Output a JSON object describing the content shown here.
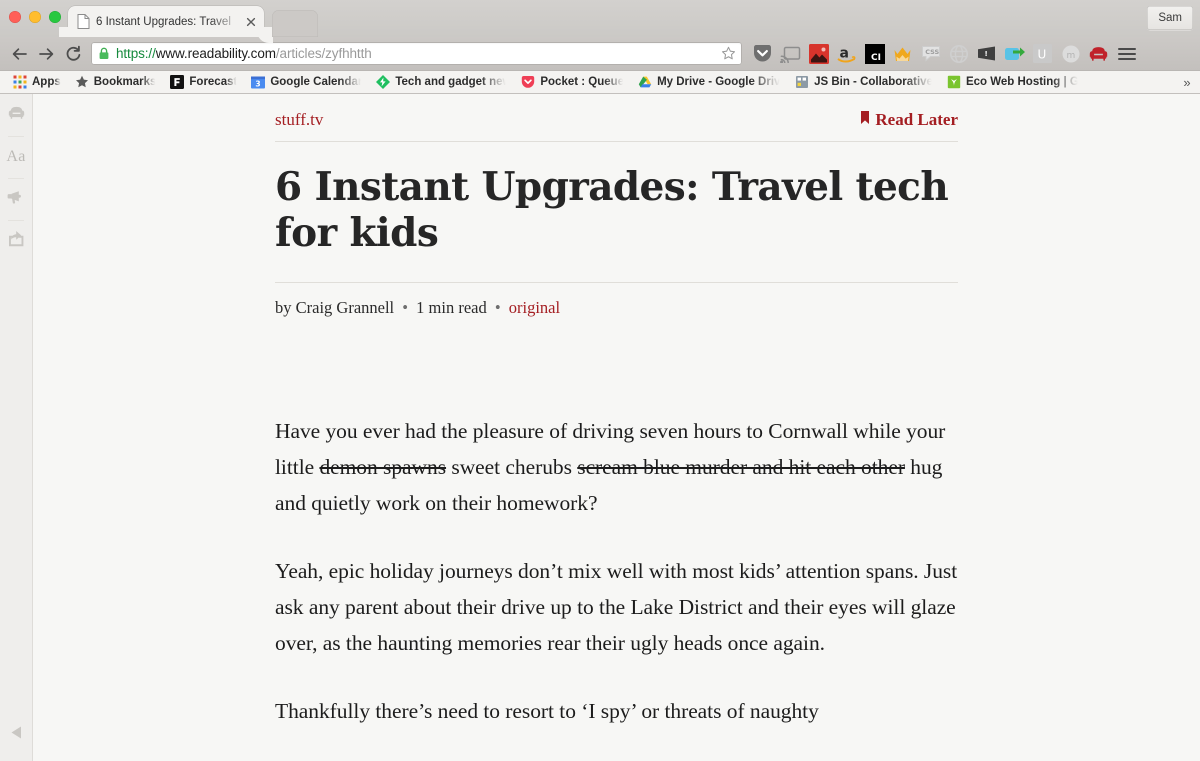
{
  "browser": {
    "window_controls": [
      "close",
      "minimize",
      "zoom"
    ],
    "tab": {
      "title": "6 Instant Upgrades: Travel",
      "favicon": "page-icon",
      "close_label": "×"
    },
    "profile_button": "Sam",
    "nav": {
      "back": "back-arrow",
      "forward": "forward-arrow",
      "reload": "reload-arrow"
    },
    "omnibox": {
      "security": "lock-icon",
      "scheme": "https://",
      "host": "www.readability.com",
      "path": "/articles/zyfhhtth",
      "full_url": "https://www.readability.com/articles/zyfhhtth",
      "bookmark_star": "star-icon"
    },
    "extensions": [
      {
        "name": "pocket-extension",
        "label": "Pocket"
      },
      {
        "name": "cast-extension",
        "label": "Cast"
      },
      {
        "name": "image-downloader-extension",
        "label": "Image Downloader"
      },
      {
        "name": "amazon-extension",
        "label": "Amazon"
      },
      {
        "name": "ci-extension",
        "label": "CI"
      },
      {
        "name": "crown-extension",
        "label": "Crown"
      },
      {
        "name": "css-extension",
        "label": "CSS"
      },
      {
        "name": "globe-extension",
        "label": "Globe"
      },
      {
        "name": "tile-extension",
        "label": "Tile"
      },
      {
        "name": "share-arrow-extension",
        "label": "Share"
      },
      {
        "name": "u-extension",
        "label": "U"
      },
      {
        "name": "m-extension",
        "label": "m"
      },
      {
        "name": "readability-extension",
        "label": "Readability"
      }
    ],
    "menu_button": "hamburger-menu",
    "bookmarks": [
      {
        "label": "Apps",
        "icon": "apps-grid-icon"
      },
      {
        "label": "Bookmarks",
        "icon": "star-icon"
      },
      {
        "label": "Forecast",
        "icon": "forecast-icon"
      },
      {
        "label": "Google Calendar",
        "icon": "calendar-icon"
      },
      {
        "label": "Tech and gadget news",
        "icon": "feed-icon"
      },
      {
        "label": "Pocket : Queue",
        "icon": "pocket-icon"
      },
      {
        "label": "My Drive - Google Drive",
        "icon": "drive-icon"
      },
      {
        "label": "JS Bin - Collaborative",
        "icon": "jsbin-icon"
      },
      {
        "label": "Eco Web Hosting | G",
        "icon": "eco-icon"
      }
    ],
    "bookmarks_overflow": "»"
  },
  "reader": {
    "rail": [
      {
        "name": "readability-logo",
        "label": "Readability"
      },
      {
        "name": "typography-settings",
        "label": "Aa"
      },
      {
        "name": "megaphone",
        "label": "Announcements"
      },
      {
        "name": "share",
        "label": "Share"
      }
    ],
    "collapse_label": "Collapse sidebar",
    "source": "stuff.tv",
    "read_later": "Read Later",
    "headline": "6 Instant Upgrades: Travel tech for kids",
    "byline": {
      "author": "by Craig Grannell",
      "read_time": "1 min read",
      "original": "original",
      "separator": "•"
    },
    "paragraphs": [
      {
        "runs": [
          {
            "text": "Have you ever had the pleasure of driving seven hours to Cornwall while your little ",
            "strike": false
          },
          {
            "text": "demon spawns",
            "strike": true
          },
          {
            "text": " sweet cherubs ",
            "strike": false
          },
          {
            "text": "scream blue murder and hit each other",
            "strike": true
          },
          {
            "text": " hug and quietly work on their homework?",
            "strike": false
          }
        ]
      },
      {
        "runs": [
          {
            "text": "Yeah, epic holiday journeys don’t mix well with most kids’ attention spans. Just ask any parent about their drive up to the Lake District and their eyes will glaze over, as the haunting memories rear their ugly heads once again.",
            "strike": false
          }
        ]
      },
      {
        "runs": [
          {
            "text": "Thankfully there’s need to resort to ‘I spy’ or threats of naughty",
            "strike": false
          }
        ]
      }
    ]
  },
  "colors": {
    "accent_red": "#a41e22",
    "page_bg": "#f7f7f5",
    "chrome_bg": "#c9c7c4",
    "url_secure_green": "#168a3d"
  }
}
